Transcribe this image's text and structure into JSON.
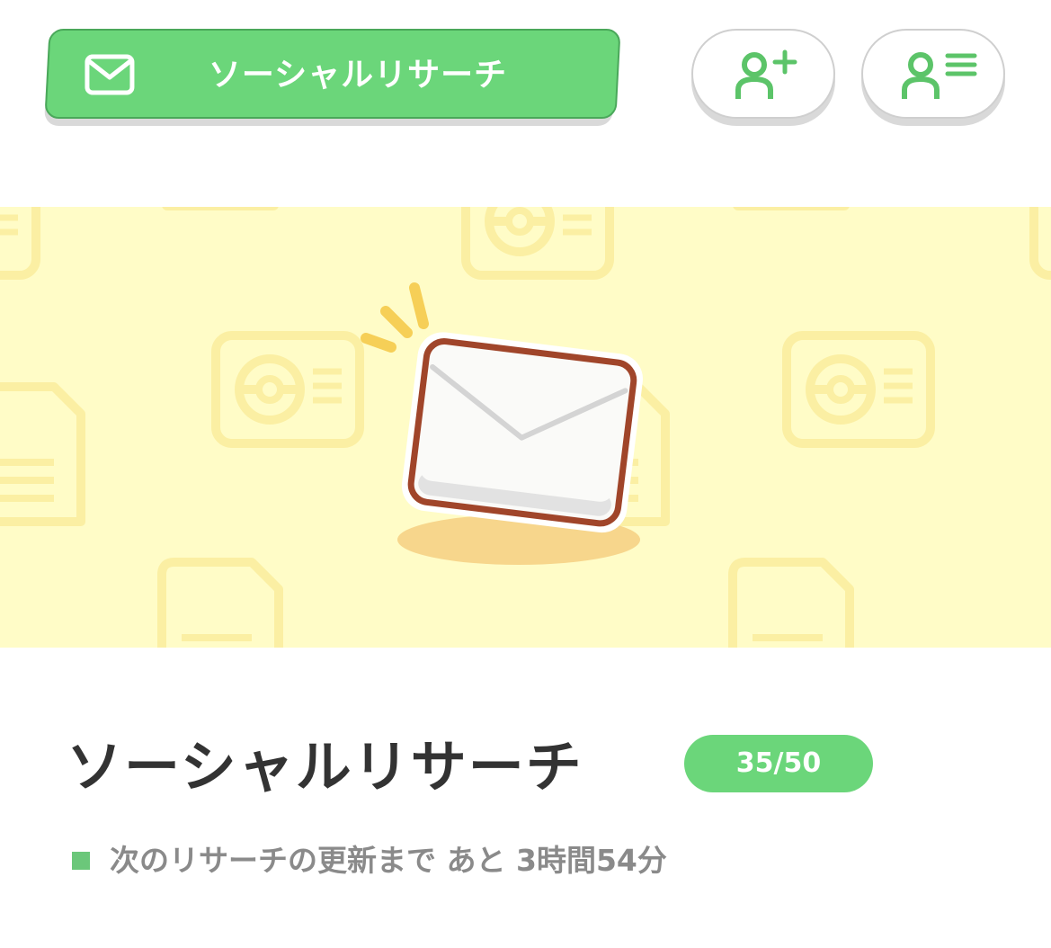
{
  "header": {
    "title": "ソーシャルリサーチ",
    "icon": "mail-icon",
    "accent_color": "#6bd67a"
  },
  "actions": [
    {
      "icon": "add-friend-icon"
    },
    {
      "icon": "friend-list-icon"
    }
  ],
  "banner": {
    "background_color": "#fffcc7",
    "illustration": "envelope-icon"
  },
  "research": {
    "title": "ソーシャルリサーチ",
    "count": "35/50",
    "refresh_text": "次のリサーチの更新まで あと 3時間54分"
  }
}
